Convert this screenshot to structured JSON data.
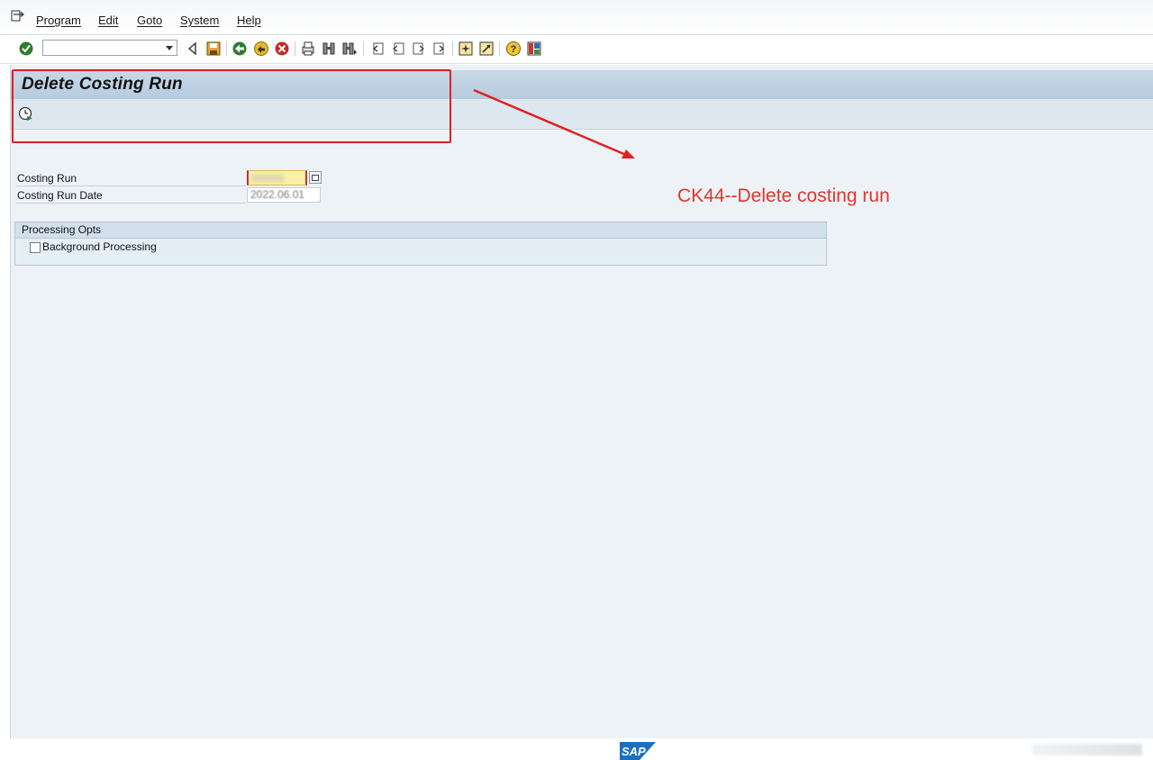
{
  "menubar": {
    "items": [
      "Program",
      "Edit",
      "Goto",
      "System",
      "Help"
    ]
  },
  "toolbar": {
    "command_field_value": "",
    "icons": [
      "enter-icon",
      "command-field",
      "back-triangle-icon",
      "save-icon",
      "back-icon",
      "exit-icon",
      "cancel-icon",
      "print-icon",
      "find-icon",
      "find-next-icon",
      "first-page-icon",
      "previous-page-icon",
      "next-page-icon",
      "last-page-icon",
      "new-session-icon",
      "shortcut-icon",
      "help-icon",
      "layout-icon"
    ]
  },
  "screen": {
    "title": "Delete Costing Run",
    "execute_icon": "execute-clock-icon"
  },
  "fields": {
    "costing_run_label": "Costing Run",
    "costing_run_value": "",
    "costing_run_date_label": "Costing Run Date",
    "costing_run_date_value": "2022.06.01"
  },
  "processing": {
    "group_title": "Processing Opts",
    "background_label": "Background Processing",
    "background_checked": false
  },
  "annotation": {
    "text": "CK44--Delete costing run",
    "color": "#e0362c"
  },
  "footer": {
    "logo": "SAP"
  }
}
